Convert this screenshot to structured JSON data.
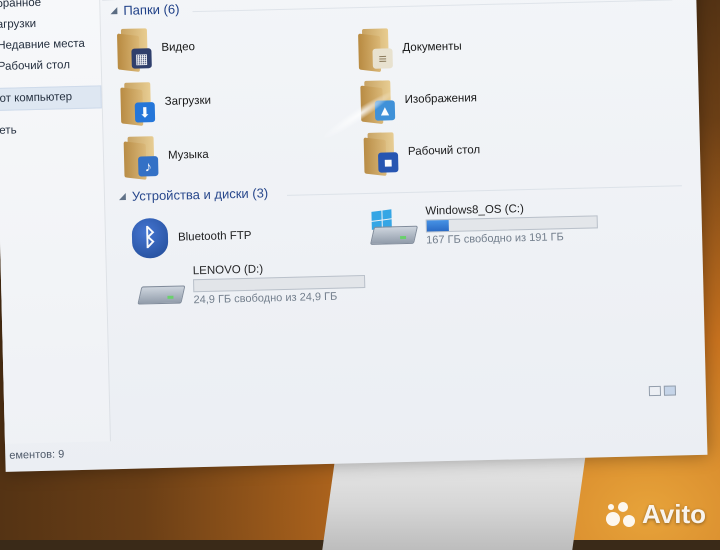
{
  "sidebar": {
    "items": [
      {
        "label": "бранное"
      },
      {
        "label": "агрузки"
      },
      {
        "label": "Недавние места"
      },
      {
        "label": "Рабочий стол"
      },
      {
        "label": "от компьютер"
      },
      {
        "label": "еть"
      }
    ]
  },
  "folders": {
    "header": "Папки (6)",
    "items": [
      {
        "label": "Видео",
        "icon": "video-folder-icon"
      },
      {
        "label": "Документы",
        "icon": "documents-folder-icon"
      },
      {
        "label": "Загрузки",
        "icon": "downloads-folder-icon"
      },
      {
        "label": "Изображения",
        "icon": "pictures-folder-icon"
      },
      {
        "label": "Музыка",
        "icon": "music-folder-icon"
      },
      {
        "label": "Рабочий стол",
        "icon": "desktop-folder-icon"
      }
    ]
  },
  "devices": {
    "header": "Устройства и диски (3)",
    "items": [
      {
        "label": "Bluetooth FTP",
        "icon": "bluetooth-icon"
      },
      {
        "label": "Windows8_OS (C:)",
        "free_text": "167 ГБ свободно из 191 ГБ",
        "used_fraction": 0.13,
        "icon": "system-drive-icon"
      },
      {
        "label": "LENOVO (D:)",
        "free_text": "24,9 ГБ свободно из 24,9 ГБ",
        "used_fraction": 0.0,
        "icon": "drive-icon"
      }
    ]
  },
  "status": {
    "text": "ементов: 9"
  },
  "watermark": {
    "text": "Avito"
  },
  "colors": {
    "accent": "#1e3f87",
    "drive_bar": "#1e63c4",
    "wallpaper": "#e7a33a"
  }
}
